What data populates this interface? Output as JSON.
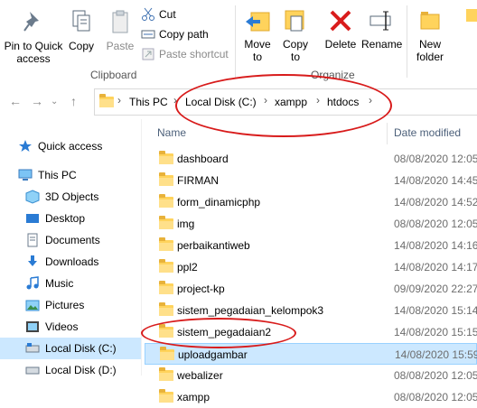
{
  "ribbon": {
    "pin_label": "Pin to Quick\naccess",
    "copy_label": "Copy",
    "paste_label": "Paste",
    "cut_label": "Cut",
    "copy_path_label": "Copy path",
    "paste_shortcut_label": "Paste shortcut",
    "clipboard_group": "Clipboard",
    "move_to_label": "Move\nto",
    "copy_to_label": "Copy\nto",
    "delete_label": "Delete",
    "rename_label": "Rename",
    "organize_group": "Organize",
    "new_folder_label": "New\nfolder"
  },
  "breadcrumb": [
    "This PC",
    "Local Disk (C:)",
    "xampp",
    "htdocs"
  ],
  "nav": [
    {
      "label": "Quick access",
      "icon": "star-icon"
    },
    {
      "label": "This PC",
      "icon": "computer-icon"
    },
    {
      "label": "3D Objects",
      "icon": "cube-icon"
    },
    {
      "label": "Desktop",
      "icon": "desktop-icon"
    },
    {
      "label": "Documents",
      "icon": "documents-icon"
    },
    {
      "label": "Downloads",
      "icon": "download-icon"
    },
    {
      "label": "Music",
      "icon": "music-icon"
    },
    {
      "label": "Pictures",
      "icon": "pictures-icon"
    },
    {
      "label": "Videos",
      "icon": "videos-icon"
    },
    {
      "label": "Local Disk (C:)",
      "icon": "drive-icon"
    },
    {
      "label": "Local Disk (D:)",
      "icon": "drive-icon"
    }
  ],
  "columns": {
    "name": "Name",
    "date": "Date modified"
  },
  "files": [
    {
      "name": "dashboard",
      "date": "08/08/2020 12:05"
    },
    {
      "name": "FIRMAN",
      "date": "14/08/2020 14:45"
    },
    {
      "name": "form_dinamicphp",
      "date": "14/08/2020 14:52"
    },
    {
      "name": "img",
      "date": "08/08/2020 12:05"
    },
    {
      "name": "perbaikantiweb",
      "date": "14/08/2020 14:16"
    },
    {
      "name": "ppl2",
      "date": "14/08/2020 14:17"
    },
    {
      "name": "project-kp",
      "date": "09/09/2020 22:27"
    },
    {
      "name": "sistem_pegadaian_kelompok3",
      "date": "14/08/2020 15:14"
    },
    {
      "name": "sistem_pegadaian2",
      "date": "14/08/2020 15:15"
    },
    {
      "name": "uploadgambar",
      "date": "14/08/2020 15:59"
    },
    {
      "name": "webalizer",
      "date": "08/08/2020 12:05"
    },
    {
      "name": "xampp",
      "date": "08/08/2020 12:05"
    }
  ],
  "colors": {
    "accent_select": "#cce8ff",
    "annotation": "#d81b1b",
    "folder": "#ffd35c"
  }
}
